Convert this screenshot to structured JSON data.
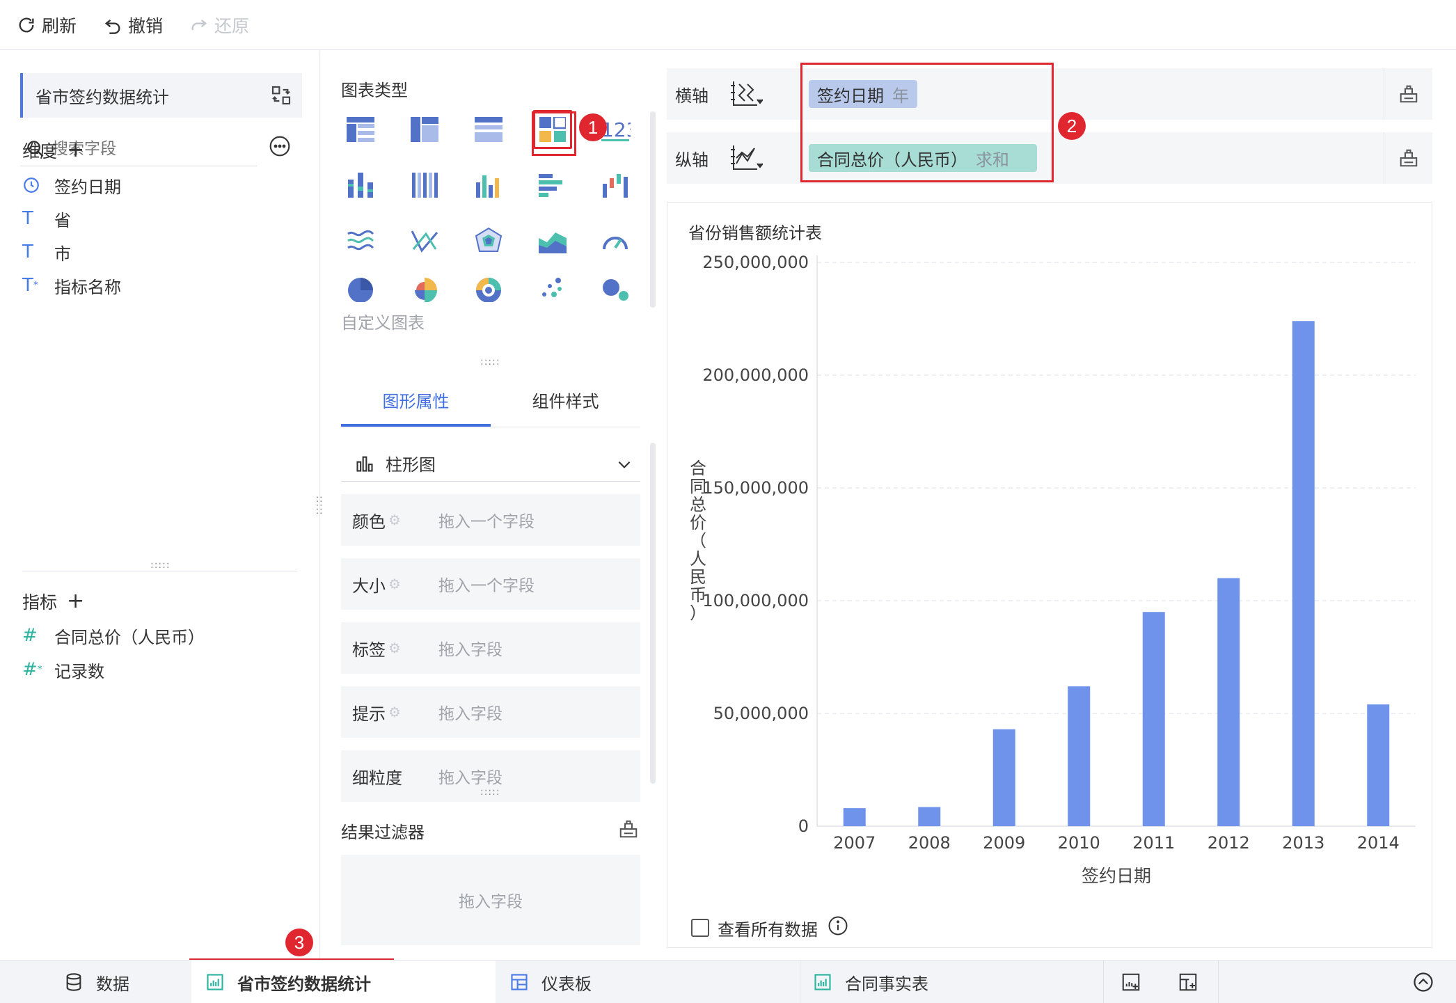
{
  "toolbar": {
    "refresh": "刷新",
    "undo": "撤销",
    "redo": "还原"
  },
  "left": {
    "dataset_title": "省市签约数据统计",
    "search_placeholder": "搜索字段",
    "dimension_header": "维度",
    "dimensions": [
      {
        "label": "签约日期",
        "icon": "clock-icon"
      },
      {
        "label": "省",
        "icon": "text-type-icon"
      },
      {
        "label": "市",
        "icon": "text-type-icon"
      },
      {
        "label": "指标名称",
        "icon": "text-star-icon"
      }
    ],
    "measure_header": "指标",
    "measures": [
      {
        "label": "合同总价（人民币）",
        "icon": "hash-icon"
      },
      {
        "label": "记录数",
        "icon": "hash-star-icon"
      }
    ]
  },
  "middle": {
    "chart_types_label": "图表类型",
    "custom_chart_label": "自定义图表",
    "tabs": [
      "图形属性",
      "组件样式"
    ],
    "chart_select": "柱形图",
    "props": [
      {
        "name": "颜色",
        "drop": "拖入一个字段"
      },
      {
        "name": "大小",
        "drop": "拖入一个字段"
      },
      {
        "name": "标签",
        "drop": "拖入字段"
      },
      {
        "name": "提示",
        "drop": "拖入字段"
      },
      {
        "name": "细粒度",
        "drop": "拖入字段"
      }
    ],
    "filter_title": "结果过滤器",
    "filter_drop": "拖入字段"
  },
  "axes": {
    "x_label": "横轴",
    "y_label": "纵轴",
    "x_field": "签约日期",
    "x_agg": "年",
    "y_field": "合同总价（人民币）",
    "y_agg": "求和"
  },
  "badges": [
    "1",
    "2",
    "3"
  ],
  "chart_data": {
    "type": "bar",
    "title": "省份销售额统计表",
    "xlabel": "签约日期",
    "ylabel": "合同总价（人民币）",
    "categories": [
      "2007",
      "2008",
      "2009",
      "2010",
      "2011",
      "2012",
      "2013",
      "2014"
    ],
    "values": [
      8000000,
      8500000,
      43000000,
      62000000,
      95000000,
      110000000,
      224000000,
      54000000
    ],
    "y_ticks": [
      "250,000,000",
      "200,000,000",
      "150,000,000",
      "100,000,000",
      "50,000,000",
      "0"
    ],
    "ylim": [
      0,
      250000000
    ],
    "grid": true,
    "bar_color": "#6f93ea"
  },
  "view_all_label": "查看所有数据",
  "bottom_tabs": [
    {
      "label": "数据",
      "icon": "database-icon"
    },
    {
      "label": "省市签约数据统计",
      "icon": "bar-chart-icon"
    },
    {
      "label": "仪表板",
      "icon": "dashboard-icon"
    },
    {
      "label": "合同事实表",
      "icon": "bar-chart-icon"
    }
  ],
  "colors": {
    "accent": "#3f6fe0",
    "highlight": "#e0262e",
    "dimension_pill": "#b9c9ec",
    "measure_pill": "#a7ddd5"
  }
}
